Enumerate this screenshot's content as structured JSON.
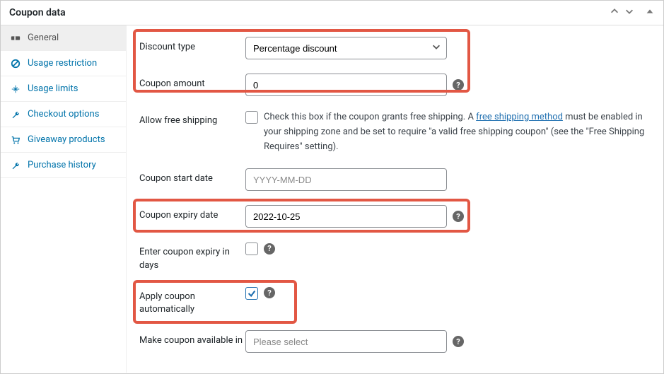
{
  "header": {
    "title": "Coupon data"
  },
  "sidebar": {
    "items": [
      {
        "label": "General"
      },
      {
        "label": "Usage restriction"
      },
      {
        "label": "Usage limits"
      },
      {
        "label": "Checkout options"
      },
      {
        "label": "Giveaway products"
      },
      {
        "label": "Purchase history"
      }
    ]
  },
  "form": {
    "discount_type": {
      "label": "Discount type",
      "value": "Percentage discount"
    },
    "coupon_amount": {
      "label": "Coupon amount",
      "value": "0"
    },
    "free_shipping": {
      "label": "Allow free shipping",
      "desc_pre": "Check this box if the coupon grants free shipping. A ",
      "link": "free shipping method",
      "desc_post": " must be enabled in your shipping zone and be set to require \"a valid free shipping coupon\" (see the \"Free Shipping Requires\" setting)."
    },
    "start_date": {
      "label": "Coupon start date",
      "placeholder": "YYYY-MM-DD",
      "value": ""
    },
    "expiry_date": {
      "label": "Coupon expiry date",
      "value": "2022-10-25"
    },
    "expiry_days": {
      "label": "Enter coupon expiry in days"
    },
    "auto_apply": {
      "label": "Apply coupon automatically",
      "checked": true
    },
    "available_in": {
      "label": "Make coupon available in",
      "placeholder": "Please select"
    },
    "help_glyph": "?"
  }
}
